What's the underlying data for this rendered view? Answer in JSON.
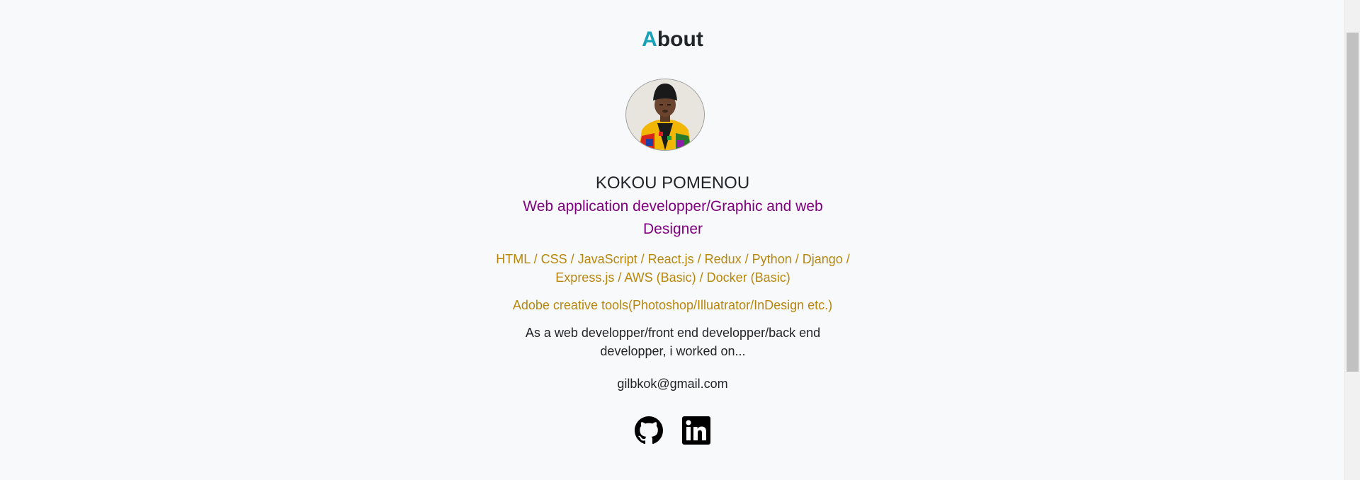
{
  "about": {
    "title_first_letter": "A",
    "title_rest": "bout",
    "name": "KOKOU POMENOU",
    "role": "Web application developper/Graphic and web Designer",
    "skills": "HTML / CSS / JavaScript / React.js / Redux / Python / Django / Express.js / AWS (Basic) / Docker (Basic)",
    "tools": "Adobe creative tools(Photoshop/Illuatrator/InDesign etc.)",
    "description": "As a web developper/front end developper/back end developper, i worked on...",
    "email": "gilbkok@gmail.com"
  },
  "icons": {
    "github": "github-icon",
    "linkedin": "linkedin-icon",
    "avatar": "profile-photo"
  },
  "colors": {
    "accent": "#17a2b8",
    "role": "#800080",
    "skills": "#b8860b",
    "text": "#212529",
    "background": "#f8f9fa"
  }
}
